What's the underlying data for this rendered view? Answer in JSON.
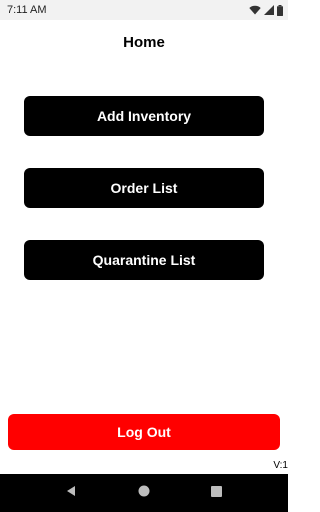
{
  "status_bar": {
    "time": "7:11 AM",
    "icons": [
      "wifi-icon",
      "signal-icon",
      "battery-icon"
    ]
  },
  "header": {
    "title": "Home"
  },
  "menu": {
    "add_inventory_label": "Add Inventory",
    "order_list_label": "Order List",
    "quarantine_list_label": "Quarantine List"
  },
  "footer": {
    "logout_label": "Log Out",
    "version": "V:1"
  },
  "colors": {
    "primary_button": "#000000",
    "logout_button": "#ff0000",
    "button_text": "#ffffff"
  },
  "nav_bar": {
    "icons": [
      "back-icon",
      "home-icon",
      "recent-apps-icon"
    ]
  }
}
